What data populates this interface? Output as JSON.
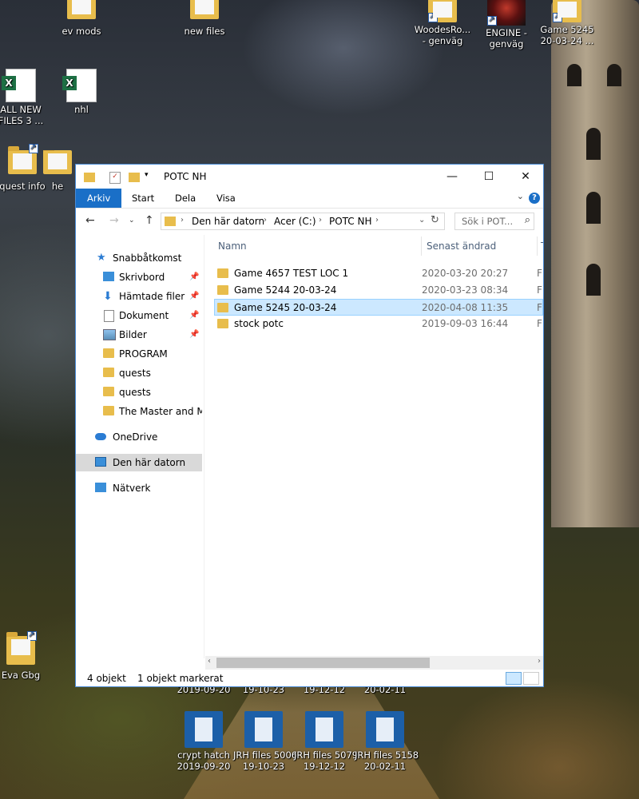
{
  "desktop": {
    "icons_top": [
      {
        "label": "ev mods",
        "type": "folder"
      },
      {
        "label": "new files",
        "type": "folder"
      },
      {
        "label": "WoodesRo...\n- genväg",
        "type": "shortcut"
      },
      {
        "label": "ENGINE -\ngenväg",
        "type": "engine"
      },
      {
        "label": "Game 5245\n20-03-24 ...",
        "type": "folder-shortcut"
      }
    ],
    "icons_left": [
      {
        "label": "ALL NEW\nFILES 3 ...",
        "type": "excel"
      },
      {
        "label": "nhl",
        "type": "excel"
      },
      {
        "label": "quest info",
        "type": "file"
      },
      {
        "label": "he",
        "type": "file"
      },
      {
        "label": "Eva Gbg",
        "type": "file"
      }
    ],
    "hidden_dates": [
      "2019-09-20",
      "19-10-23",
      "19-12-12",
      "20-02-11"
    ],
    "zip_icons": [
      {
        "label": "crypt hatch",
        "date": "2019-09-20"
      },
      {
        "label": "JRH files 5006",
        "date": "19-10-23"
      },
      {
        "label": "JRH files 5079",
        "date": "19-12-12"
      },
      {
        "label": "JRH files 5158",
        "date": "20-02-11"
      }
    ]
  },
  "window": {
    "title": "POTC NH",
    "controls": {
      "minimize": "—",
      "maximize": "☐",
      "close": "✕"
    },
    "ribbon_tabs": [
      "Arkiv",
      "Start",
      "Dela",
      "Visa"
    ],
    "help": "?",
    "address": {
      "crumbs": [
        "Den här datorn",
        "Acer (C:)",
        "POTC NH"
      ]
    },
    "search": {
      "placeholder": "Sök i POT..."
    },
    "nav": [
      {
        "label": "Snabbåtkomst",
        "icon": "star-icon",
        "pinned": false
      },
      {
        "label": "Skrivbord",
        "icon": "desktop-icon",
        "pinned": true
      },
      {
        "label": "Hämtade filer",
        "icon": "download-icon",
        "pinned": true
      },
      {
        "label": "Dokument",
        "icon": "document-icon",
        "pinned": true
      },
      {
        "label": "Bilder",
        "icon": "pictures-icon",
        "pinned": true
      },
      {
        "label": "PROGRAM",
        "icon": "folder-icon",
        "pinned": false
      },
      {
        "label": "quests",
        "icon": "folder-icon",
        "pinned": false
      },
      {
        "label": "quests",
        "icon": "folder-icon",
        "pinned": false
      },
      {
        "label": "The Master and Mar",
        "icon": "folder-icon",
        "pinned": false
      },
      {
        "label": "OneDrive",
        "icon": "cloud-icon",
        "pinned": false
      },
      {
        "label": "Den här datorn",
        "icon": "computer-icon",
        "pinned": false,
        "selected": true
      },
      {
        "label": "Nätverk",
        "icon": "network-icon",
        "pinned": false
      }
    ],
    "columns": {
      "name": "Namn",
      "modified": "Senast ändrad",
      "type": "T"
    },
    "files": [
      {
        "name": "Game 4657 TEST LOC 1",
        "modified": "2020-03-20 20:27",
        "type": "F",
        "selected": false
      },
      {
        "name": "Game 5244 20-03-24",
        "modified": "2020-03-23 08:34",
        "type": "F",
        "selected": false
      },
      {
        "name": "Game 5245 20-03-24",
        "modified": "2020-04-08 11:35",
        "type": "F",
        "selected": true
      },
      {
        "name": "stock potc",
        "modified": "2019-09-03 16:44",
        "type": "F",
        "selected": false
      }
    ],
    "status": {
      "count": "4 objekt",
      "selection": "1 objekt markerat"
    }
  },
  "colors": {
    "accent": "#1a6fc7",
    "selection": "#cce8ff",
    "folder": "#e8bd4c",
    "nav_selected": "#d9d9d9"
  }
}
